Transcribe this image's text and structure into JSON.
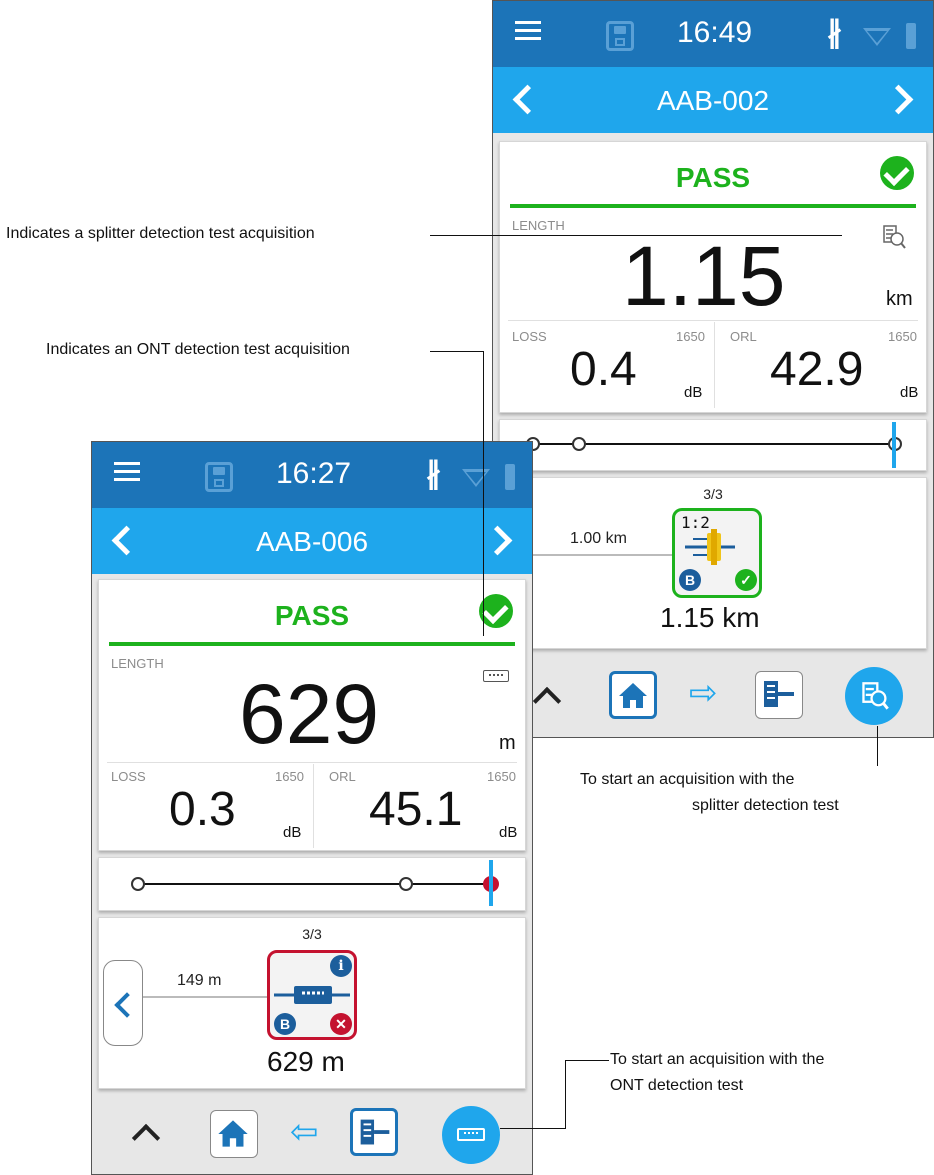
{
  "screen_a": {
    "time": "16:49",
    "title": "AAB-002",
    "verdict": "PASS",
    "length_label": "LENGTH",
    "length_value": "1.15",
    "length_unit": "km",
    "loss_label": "LOSS",
    "loss_wavelength": "1650",
    "loss_value": "0.4",
    "loss_unit": "dB",
    "orl_label": "ORL",
    "orl_wavelength": "1650",
    "orl_value": "42.9",
    "orl_unit": "dB",
    "pager": "3/3",
    "segment_distance": "1.00 km",
    "element_ratio": "1:2",
    "element_badge": "B",
    "element_distance": "1.15 km",
    "test_icon": "splitter-detection-icon"
  },
  "screen_b": {
    "time": "16:27",
    "title": "AAB-006",
    "verdict": "PASS",
    "length_label": "LENGTH",
    "length_value": "629",
    "length_unit": "m",
    "loss_label": "LOSS",
    "loss_wavelength": "1650",
    "loss_value": "0.3",
    "loss_unit": "dB",
    "orl_label": "ORL",
    "orl_wavelength": "1650",
    "orl_value": "45.1",
    "orl_unit": "dB",
    "pager": "3/3",
    "segment_distance": "149 m",
    "element_badge": "B",
    "element_distance": "629 m",
    "test_icon": "ont-detection-icon"
  },
  "annotations": {
    "splitter_indicator": "Indicates a splitter detection test acquisition",
    "ont_indicator": "Indicates an ONT detection test acquisition",
    "splitter_start_line1": "To start an acquisition with the",
    "splitter_start_line2": "splitter detection test",
    "ont_start_line1": "To start an acquisition with the",
    "ont_start_line2": "ONT detection test"
  },
  "colors": {
    "status_bar": "#1c74b8",
    "title_bar": "#1fa6ec",
    "pass_green": "#1db21d",
    "fail_red": "#c4122f"
  }
}
